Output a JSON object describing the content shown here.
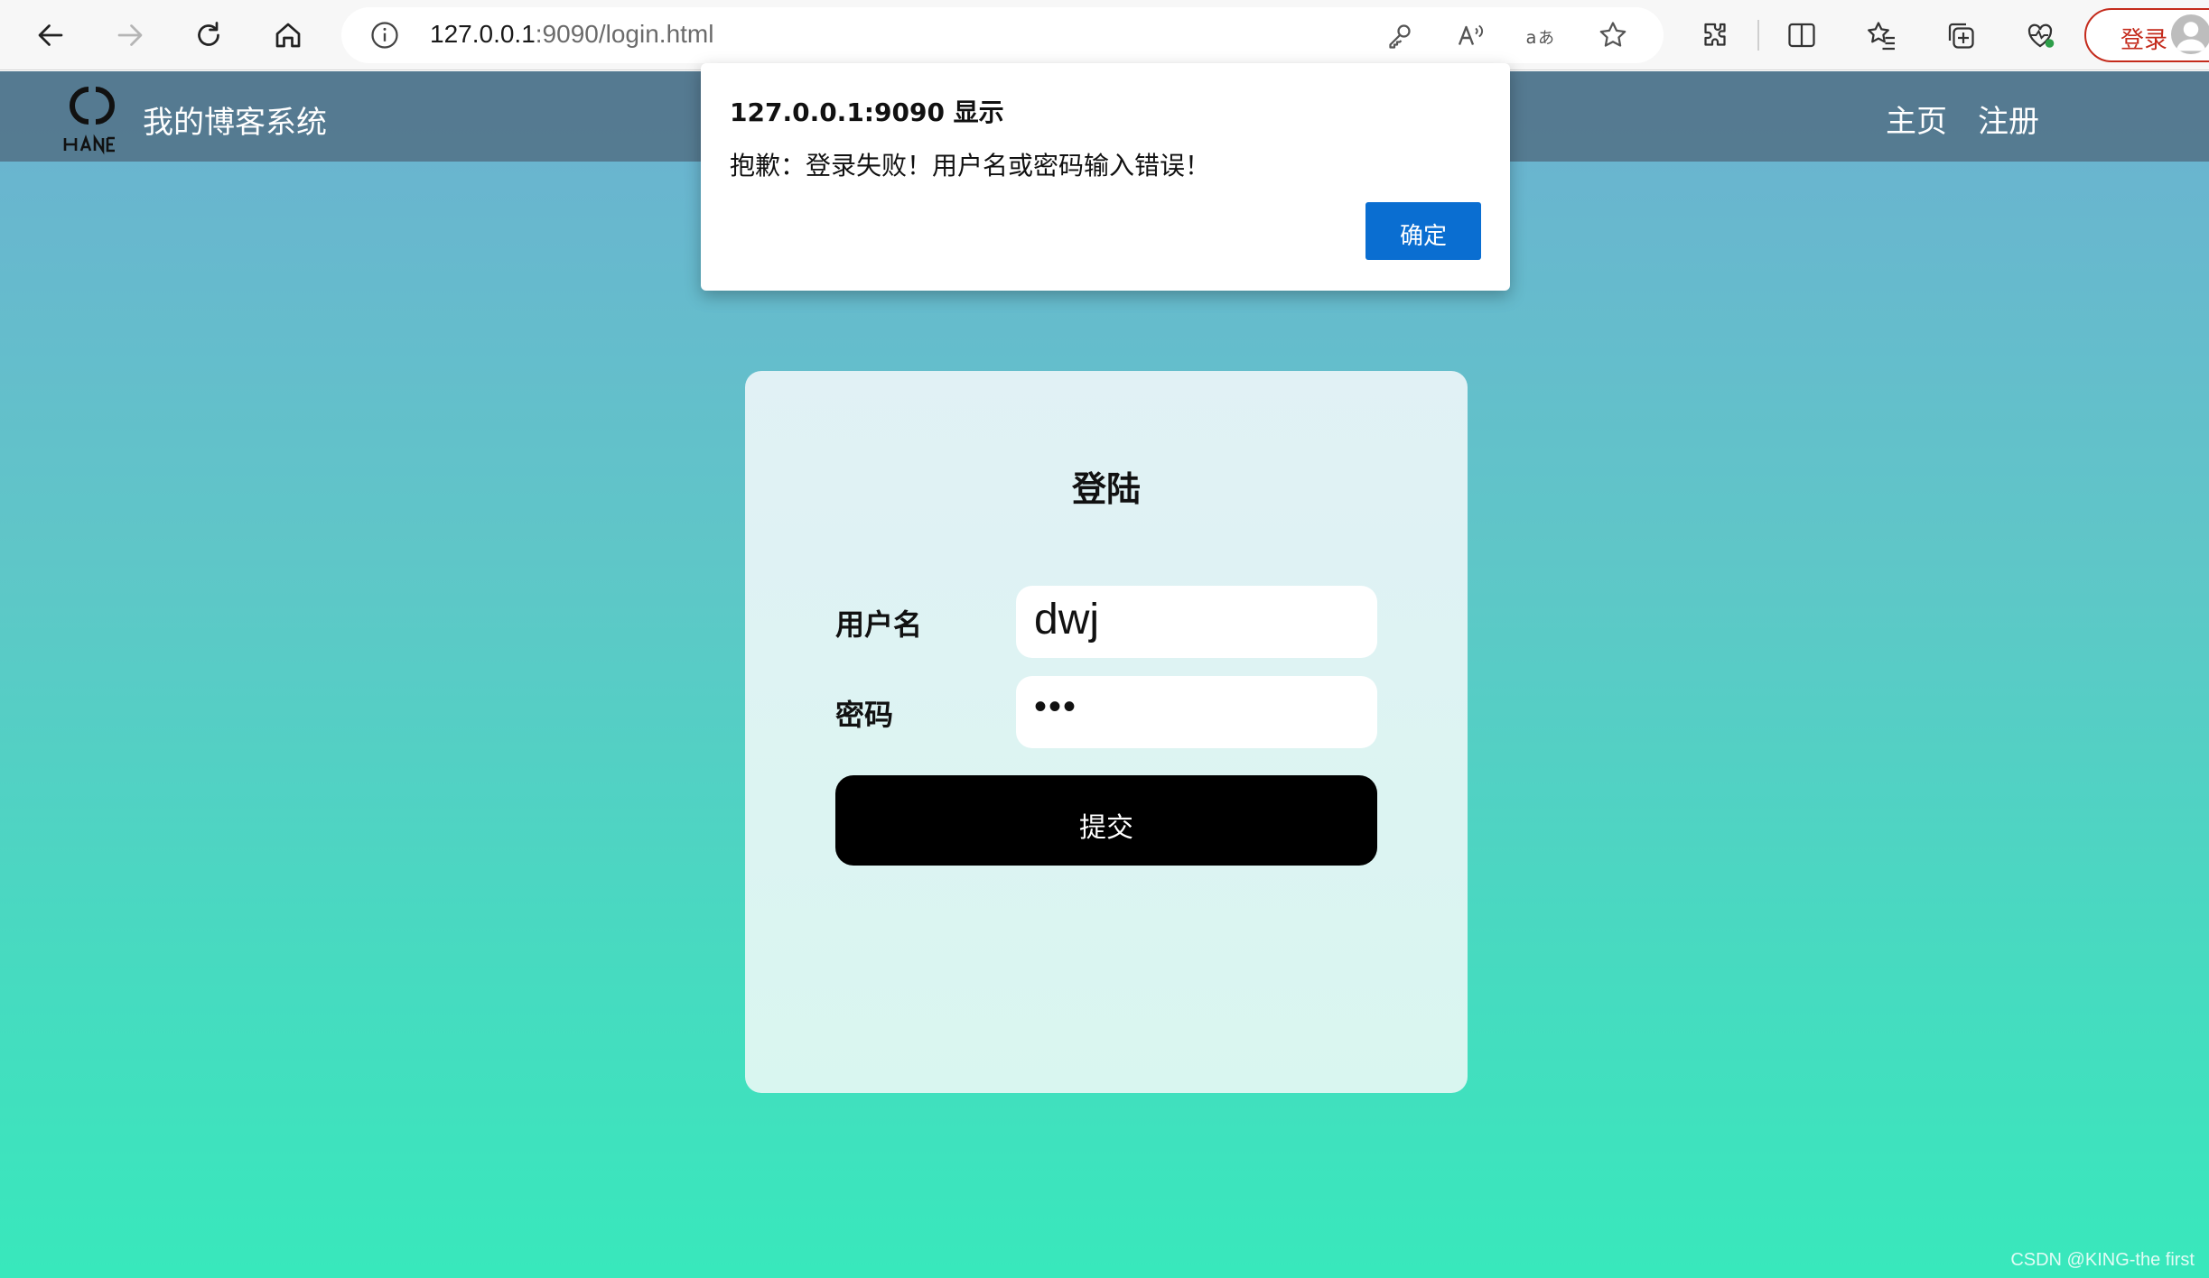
{
  "browser": {
    "url_host": "127.0.0.1",
    "url_rest": ":9090/login.html",
    "profile_label": "登录",
    "icons": [
      "back-icon",
      "forward-icon",
      "refresh-icon",
      "home-icon",
      "info-icon",
      "key-icon",
      "read-aloud-icon",
      "translate-icon",
      "favorite-star-icon",
      "extensions-icon",
      "split-screen-icon",
      "favorites-icon",
      "collections-icon",
      "health-icon"
    ]
  },
  "site": {
    "title": "我的博客系统",
    "nav": {
      "home": "主页",
      "register": "注册"
    }
  },
  "login_card": {
    "title": "登陆",
    "username_label": "用户名",
    "username_value": "dwj",
    "password_label": "密码",
    "password_value": "•••",
    "submit_label": "提交"
  },
  "alert": {
    "title": "127.0.0.1:9090 显示",
    "message": "抱歉：登录失败！用户名或密码输入错误！",
    "ok_label": "确定"
  },
  "watermark": "CSDN @KING-the first",
  "colors": {
    "accent": "#0a6ed1",
    "profile": "#c42b1c",
    "nav_bg": "#506e82"
  }
}
